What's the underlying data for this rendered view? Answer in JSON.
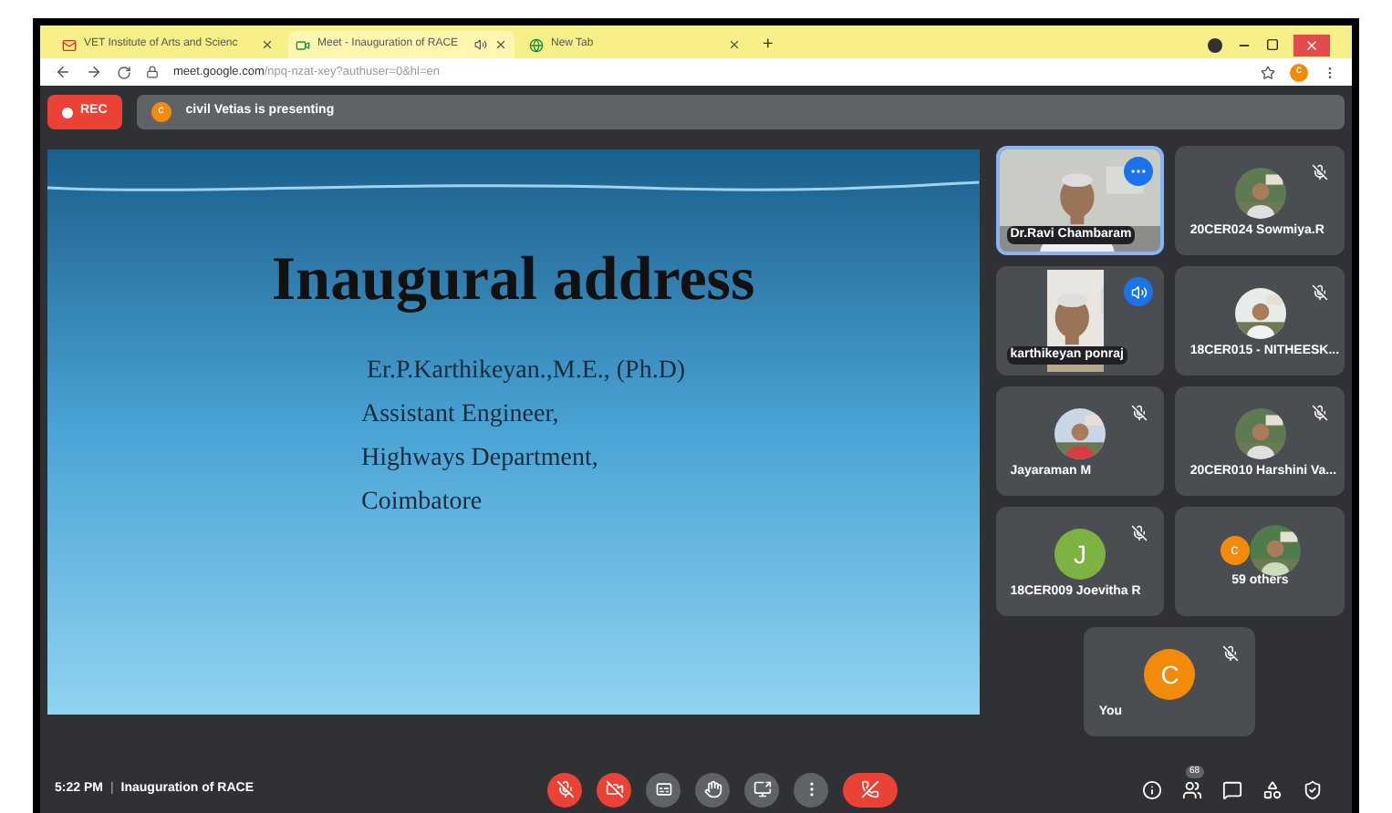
{
  "browser": {
    "tabs": [
      {
        "title": "VET Institute of Arts and Scienc",
        "kind": "mail",
        "selected": false,
        "audio": false
      },
      {
        "title": "Meet - Inauguration of RACE",
        "kind": "meet",
        "selected": true,
        "audio": true
      },
      {
        "title": "New Tab",
        "kind": "newtab",
        "selected": false,
        "audio": false
      }
    ],
    "new_tab": "+",
    "address": {
      "host": "meet.google.com",
      "path": "/npq-nzat-xey?authuser=0&hl=en"
    },
    "profile": "c"
  },
  "rec": "REC",
  "presenting": {
    "avatar": "c",
    "text": "civil Vetias is presenting"
  },
  "slide": {
    "title": "Inaugural address",
    "lines": [
      "Er.P.Karthikeyan.,M.E., (Ph.D)",
      "Assistant Engineer,",
      "Highways Department,",
      "Coimbatore"
    ]
  },
  "participants": [
    {
      "name": "Dr.Ravi Chambaram",
      "kind": "video",
      "muted": false,
      "speaking": false,
      "hovered": true,
      "selected": true
    },
    {
      "name": "20CER024 Sowmiya.R",
      "muted": true,
      "speaking": false,
      "hovered": false,
      "selected": false
    },
    {
      "name": "karthikeyan ponraj",
      "kind": "video",
      "muted": false,
      "speaking": true,
      "hovered": false,
      "selected": false
    },
    {
      "name": "18CER015 - NITHEESK...",
      "muted": true,
      "speaking": false,
      "hovered": false,
      "selected": false
    },
    {
      "name": "Jayaraman M",
      "muted": true,
      "speaking": false,
      "hovered": false,
      "selected": false
    },
    {
      "name": "20CER010 Harshini Va...",
      "muted": true,
      "speaking": false,
      "hovered": false,
      "selected": false
    },
    {
      "name": "18CER009 Joevitha R",
      "kind": "initial",
      "initial": "J",
      "color": "#7cb342",
      "muted": true,
      "speaking": false,
      "hovered": false,
      "selected": false
    },
    {
      "name": "59 others",
      "kind": "others",
      "initial": "c",
      "color": "#f28b0c",
      "muted": false,
      "speaking": false,
      "hovered": false,
      "selected": false
    },
    {
      "name": "You",
      "kind": "initial",
      "initial": "C",
      "color": "#f28b0c",
      "muted": true,
      "speaking": false,
      "hovered": false,
      "selected": false
    }
  ],
  "footer": {
    "time": "5:22 PM",
    "separator": "|",
    "meeting": "Inauguration of RACE"
  },
  "controls": [
    {
      "kind": "mic",
      "off": true
    },
    {
      "kind": "camera",
      "off": true
    },
    {
      "kind": "captions",
      "off": false
    },
    {
      "kind": "hand",
      "off": false
    },
    {
      "kind": "present",
      "off": false
    },
    {
      "kind": "more",
      "off": false
    },
    {
      "kind": "leave",
      "off": true
    }
  ],
  "people_count": "68"
}
